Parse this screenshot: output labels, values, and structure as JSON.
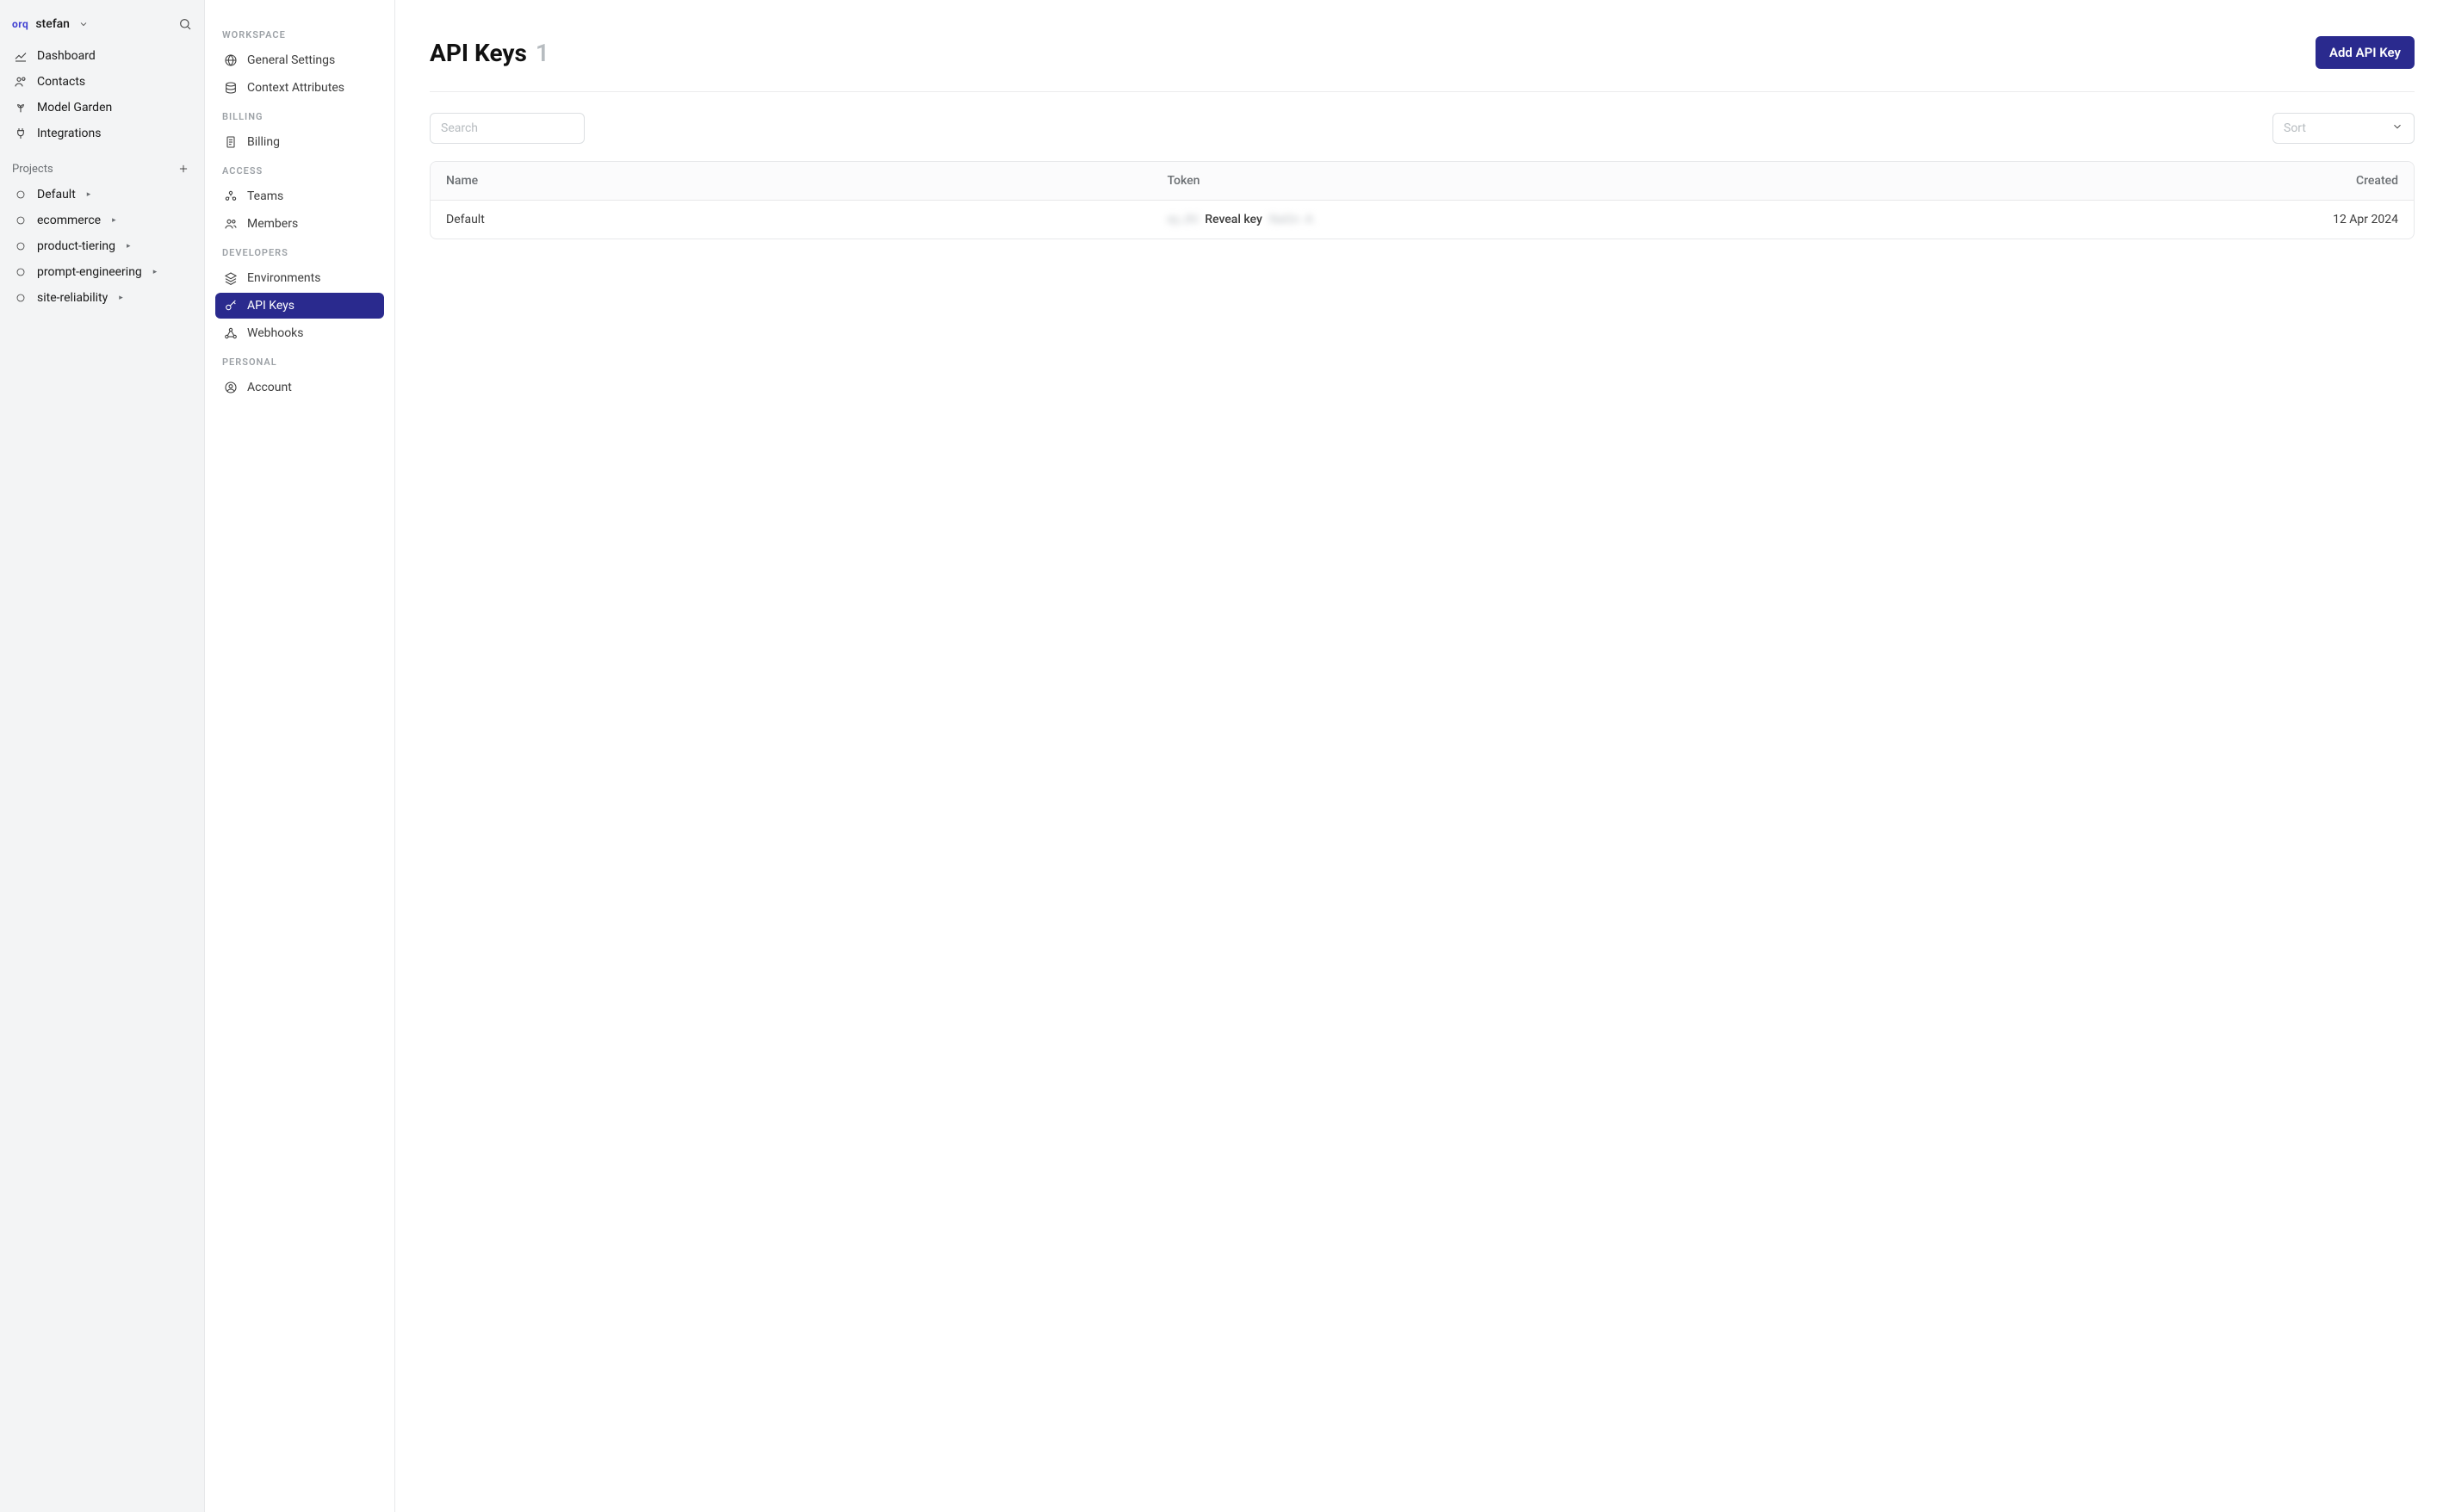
{
  "workspace": {
    "logo_text": "orq",
    "name": "stefan"
  },
  "nav1": {
    "items": [
      {
        "label": "Dashboard"
      },
      {
        "label": "Contacts"
      },
      {
        "label": "Model Garden"
      },
      {
        "label": "Integrations"
      }
    ]
  },
  "projects": {
    "heading": "Projects",
    "items": [
      {
        "label": "Default"
      },
      {
        "label": "ecommerce"
      },
      {
        "label": "product-tiering"
      },
      {
        "label": "prompt-engineering"
      },
      {
        "label": "site-reliability"
      }
    ]
  },
  "settings_nav": {
    "groups": [
      {
        "label": "WORKSPACE",
        "items": [
          {
            "label": "General Settings",
            "icon": "globe-icon"
          },
          {
            "label": "Context Attributes",
            "icon": "layers-icon"
          }
        ]
      },
      {
        "label": "BILLING",
        "items": [
          {
            "label": "Billing",
            "icon": "receipt-icon"
          }
        ]
      },
      {
        "label": "ACCESS",
        "items": [
          {
            "label": "Teams",
            "icon": "team-icon"
          },
          {
            "label": "Members",
            "icon": "members-icon"
          }
        ]
      },
      {
        "label": "DEVELOPERS",
        "items": [
          {
            "label": "Environments",
            "icon": "stack-icon"
          },
          {
            "label": "API Keys",
            "icon": "key-icon",
            "active": true
          },
          {
            "label": "Webhooks",
            "icon": "webhook-icon"
          }
        ]
      },
      {
        "label": "PERSONAL",
        "items": [
          {
            "label": "Account",
            "icon": "account-icon"
          }
        ]
      }
    ]
  },
  "page": {
    "title": "API Keys",
    "count": "1",
    "add_button": "Add API Key",
    "search_placeholder": "Search",
    "sort_placeholder": "Sort"
  },
  "table": {
    "columns": {
      "name": "Name",
      "token": "Token",
      "created": "Created"
    },
    "rows": [
      {
        "name": "Default",
        "token_prefix": "ey.Jhl",
        "reveal_label": "Reveal key",
        "token_suffix": "NaGn -A",
        "created": "12 Apr 2024"
      }
    ]
  }
}
